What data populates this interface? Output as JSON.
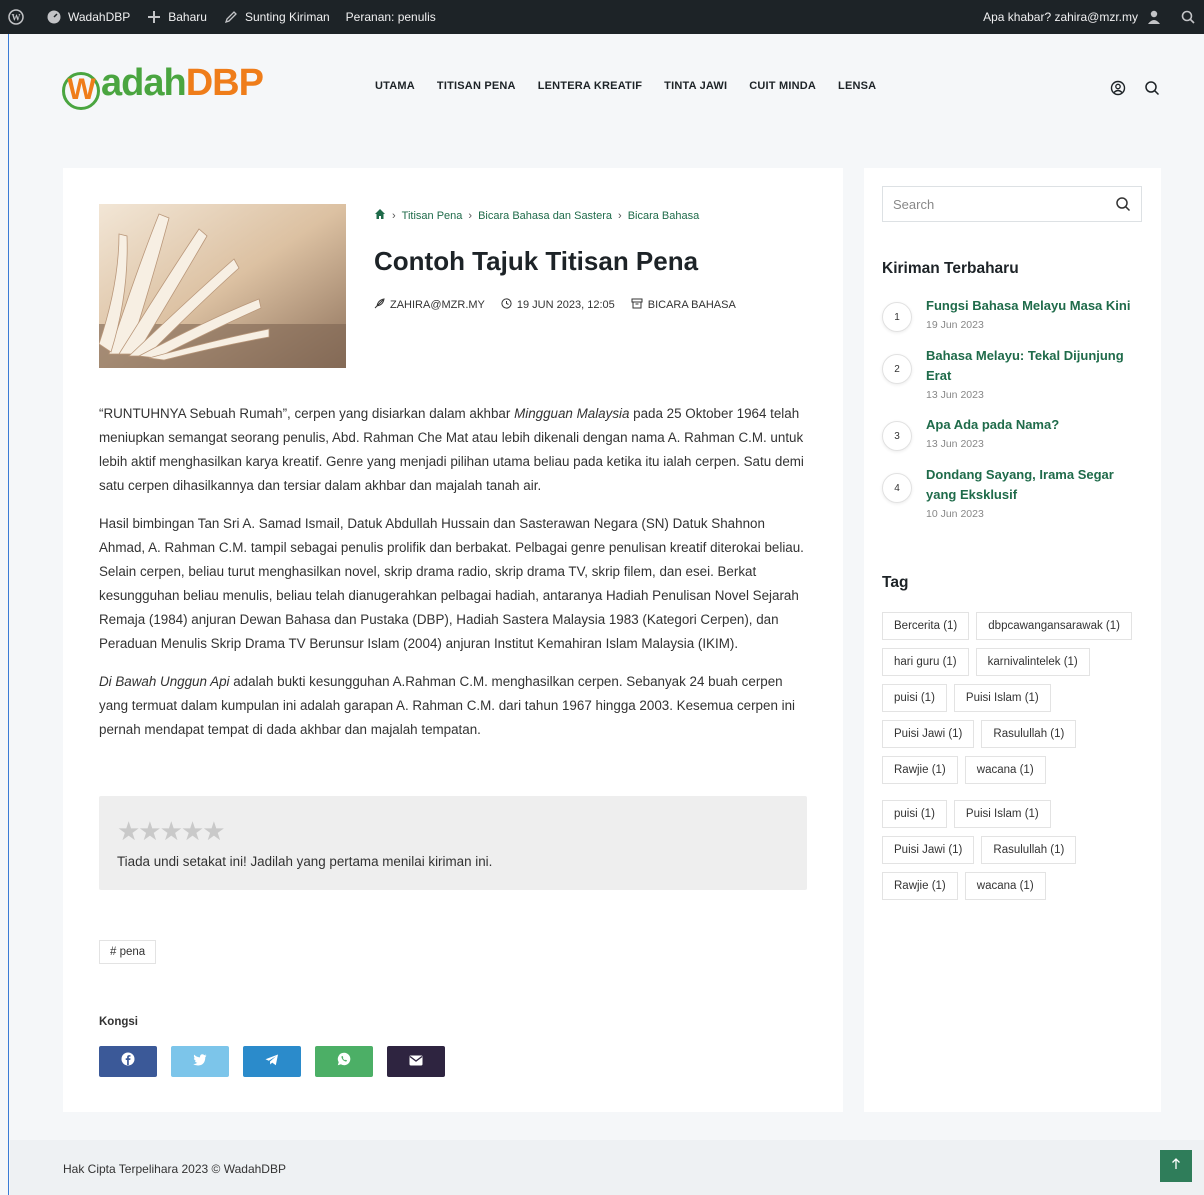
{
  "adminbar": {
    "site_name": "WadahDBP",
    "new_label": "Baharu",
    "edit_label": "Sunting Kiriman",
    "role_label": "Peranan: penulis",
    "greeting": "Apa khabar? zahira@mzr.my"
  },
  "header": {
    "logo_text_w": "W",
    "logo_text_adah": "adah",
    "logo_text_dbp": "DBP",
    "nav": [
      "UTAMA",
      "TITISAN PENA",
      "LENTERA KREATIF",
      "TINTA JAWI",
      "CUIT MINDA",
      "LENSA"
    ]
  },
  "post": {
    "breadcrumb": [
      "Titisan Pena",
      "Bicara Bahasa dan Sastera",
      "Bicara Bahasa"
    ],
    "title": "Contoh Tajuk Titisan Pena",
    "author": "ZAHIRA@MZR.MY",
    "date": "19 JUN 2023, 12:05",
    "category": "BICARA BAHASA",
    "p1_a": "“RUNTUHNYA Sebuah Rumah”, cerpen yang disiarkan dalam akhbar ",
    "p1_em": "Mingguan Malaysia",
    "p1_b": "  pada 25 Oktober 1964 telah meniupkan semangat seorang penulis, Abd. Rahman Che Mat atau lebih dikenali dengan nama A. Rahman C.M. untuk lebih aktif menghasilkan karya kreatif.  Genre yang menjadi pilihan utama beliau pada ketika itu ialah cerpen. Satu demi satu cerpen dihasilkannya dan tersiar dalam akhbar dan majalah tanah air.",
    "p2": "Hasil bimbingan Tan Sri A. Samad Ismail, Datuk Abdullah Hussain dan Sasterawan Negara (SN) Datuk Shahnon Ahmad, A. Rahman C.M. tampil sebagai penulis prolifik dan  berbakat.  Pelbagai genre penulisan kreatif diterokai beliau.  Selain cerpen, beliau turut menghasilkan novel, skrip drama radio, skrip drama TV, skrip filem, dan esei. Berkat kesungguhan beliau menulis, beliau telah dianugerahkan pelbagai hadiah, antaranya Hadiah Penulisan Novel Sejarah Remaja (1984) anjuran Dewan Bahasa dan Pustaka (DBP), Hadiah Sastera Malaysia 1983 (Kategori Cerpen), dan Peraduan Menulis Skrip Drama TV Berunsur Islam (2004) anjuran Institut Kemahiran Islam Malaysia (IKIM).",
    "p3_em": "Di Bawah Unggun Api",
    "p3_b": " adalah bukti kesungguhan A.Rahman C.M. menghasilkan cerpen. Sebanyak 24 buah cerpen yang termuat dalam kumpulan ini  adalah garapan A. Rahman C.M. dari tahun 1967 hingga 2003. Kesemua cerpen ini pernah mendapat tempat di dada akhbar dan majalah tempatan.",
    "rating_stars": "★★★★★",
    "rating_value": 0,
    "rating_max": 5,
    "rating_text": "Tiada undi setakat ini! Jadilah yang pertama menilai kiriman ini.",
    "tag": "# pena",
    "share_label": "Kongsi"
  },
  "share_colors": {
    "facebook": "#3b5998",
    "twitter": "#7cc5ea",
    "telegram": "#2b8bcb",
    "whatsapp": "#4caf66",
    "email": "#2e2440"
  },
  "sidebar": {
    "search_placeholder": "Search",
    "recent_title": "Kiriman Terbaharu",
    "recent": [
      {
        "num": "1",
        "title": "Fungsi Bahasa Melayu Masa Kini",
        "date": "19 Jun 2023"
      },
      {
        "num": "2",
        "title": "Bahasa Melayu: Tekal Dijunjung Erat",
        "date": "13 Jun 2023"
      },
      {
        "num": "3",
        "title": "Apa Ada pada Nama?",
        "date": "13 Jun 2023"
      },
      {
        "num": "4",
        "title": "Dondang Sayang, Irama Segar yang Eksklusif",
        "date": "10 Jun 2023"
      }
    ],
    "tag_title": "Tag",
    "tags": [
      "Bercerita (1)",
      "dbpcawangansarawak (1)",
      "hari guru (1)",
      "karnivalintelek (1)",
      "puisi (1)",
      "Puisi Islam (1)",
      "Puisi Jawi (1)",
      "Rasulullah (1)",
      "Rawjie (1)",
      "wacana (1)",
      "puisi (1)",
      "Puisi Islam (1)",
      "Puisi Jawi (1)",
      "Rasulullah (1)",
      "Rawjie (1)",
      "wacana (1)"
    ]
  },
  "footer": {
    "copyright": "Hak Cipta Terpelihara 2023 © WadahDBP"
  },
  "colors": {
    "accent_green": "#1f6b4a",
    "logo_green": "#4aa540",
    "logo_orange": "#ef7d1a",
    "adminbar_bg": "#1d2327"
  }
}
